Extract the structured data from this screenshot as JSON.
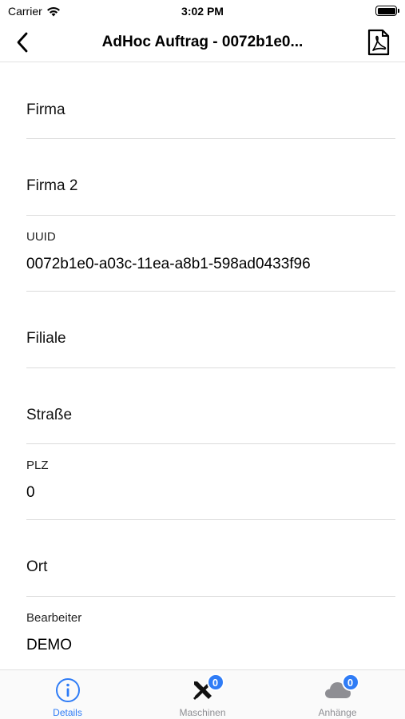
{
  "status_bar": {
    "carrier": "Carrier",
    "time": "3:02 PM"
  },
  "nav": {
    "title": "AdHoc Auftrag - 0072b1e0..."
  },
  "fields": {
    "firma": {
      "placeholder": "Firma"
    },
    "firma2": {
      "placeholder": "Firma 2"
    },
    "uuid": {
      "label": "UUID",
      "value": "0072b1e0-a03c-11ea-a8b1-598ad0433f96"
    },
    "filiale": {
      "placeholder": "Filiale"
    },
    "strasse": {
      "placeholder": "Straße"
    },
    "plz": {
      "label": "PLZ",
      "value": "0"
    },
    "ort": {
      "placeholder": "Ort"
    },
    "bearbeiter": {
      "label": "Bearbeiter",
      "value": "DEMO"
    }
  },
  "tabs": [
    {
      "label": "Details",
      "badge": ""
    },
    {
      "label": "Maschinen",
      "badge": "0"
    },
    {
      "label": "Anhänge",
      "badge": "0"
    }
  ],
  "colors": {
    "accent": "#2f7cf6",
    "inactive": "#8e8e93"
  }
}
